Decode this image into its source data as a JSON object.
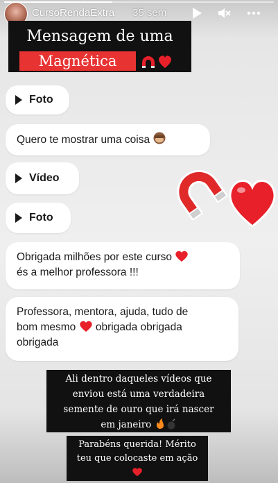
{
  "story": {
    "username": "CursoRendaExtra",
    "time_ago": "35 sem",
    "progress": 0.4
  },
  "title": {
    "line1": "Mensagem de uma",
    "line2": "Magnética"
  },
  "messages": [
    {
      "type": "media",
      "label": "Foto"
    },
    {
      "type": "text",
      "text": "Quero te mostrar uma coisa",
      "emoji": "see-no-evil-monkey"
    },
    {
      "type": "media",
      "label": "Vídeo"
    },
    {
      "type": "media",
      "label": "Foto"
    },
    {
      "type": "text",
      "line1": "Obrigada milhões por este curso",
      "line2": "és a melhor professora !!!",
      "emoji": "red-heart"
    },
    {
      "type": "text",
      "line1": "Professora, mentora, ajuda, tudo de",
      "line2a": "bom mesmo",
      "line2b": "obrigada obrigada",
      "line3": "obrigada",
      "emoji": "red-heart"
    }
  ],
  "captions": {
    "c1_l1": "Ali dentro daqueles vídeos que",
    "c1_l2": "enviou está uma verdadeira",
    "c1_l3": "semente de ouro que irá nascer",
    "c1_l4": "em janeiro",
    "c2_l1": "Parabéns querida! Mérito",
    "c2_l2": "teu que colocaste em ação"
  },
  "colors": {
    "accent_red": "#e83333",
    "heart": "#e8202a",
    "caption_bg": "#111111",
    "bubble_bg": "#ffffff"
  }
}
